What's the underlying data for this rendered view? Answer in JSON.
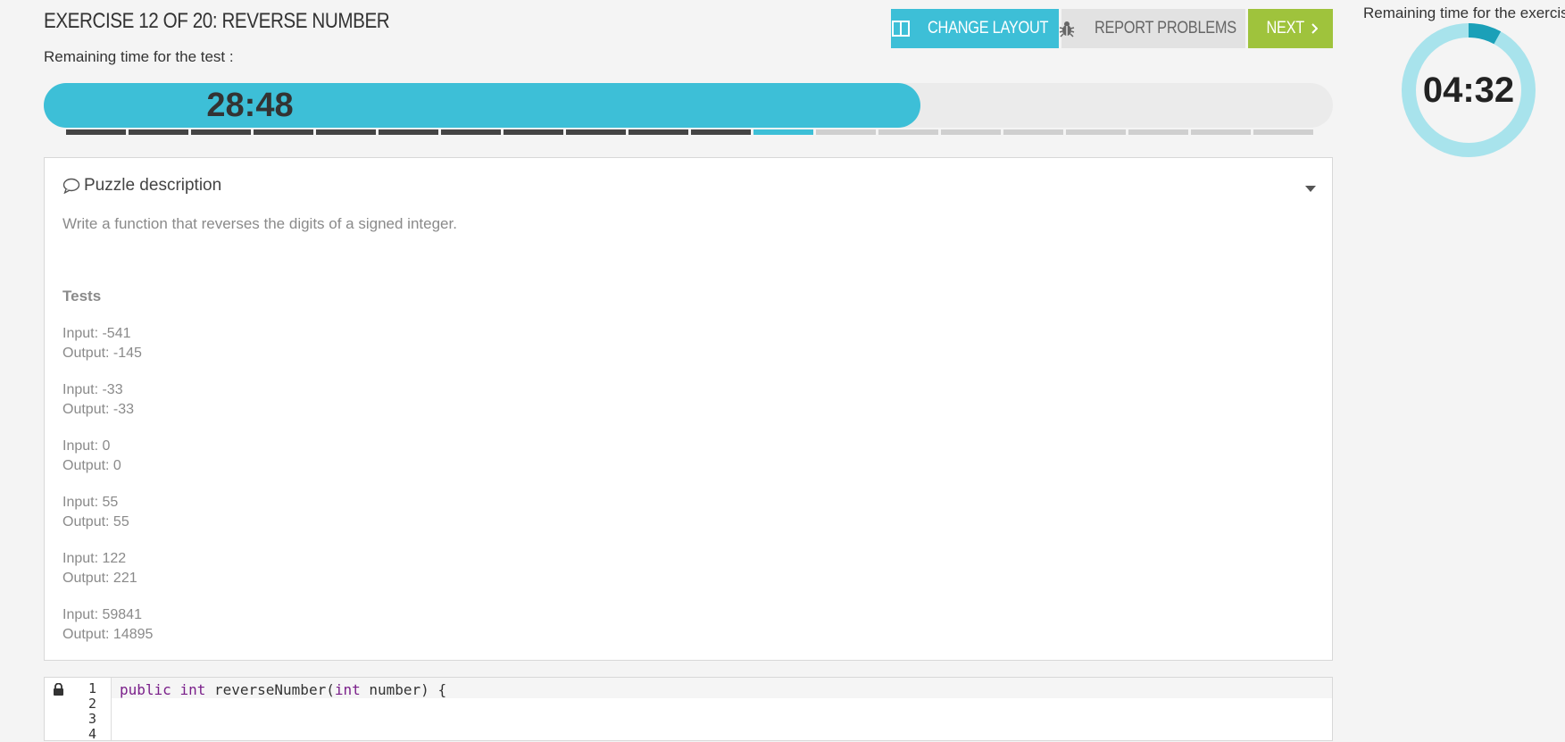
{
  "header": {
    "title": "EXERCISE 12 OF 20: REVERSE NUMBER",
    "remaining_test_label": "Remaining time for the test :"
  },
  "toolbar": {
    "change_layout_label": "CHANGE LAYOUT",
    "change_layout_icon": "columns-icon",
    "report_problems_label": "REPORT PROBLEMS",
    "report_problems_icon": "bug-icon",
    "next_label": "NEXT",
    "next_icon": "chevron-right-icon"
  },
  "test_timer": {
    "time": "28:48",
    "progress_fraction": 0.68
  },
  "exercise_progress": {
    "current": 12,
    "total": 20
  },
  "exercise_timer": {
    "label": "Remaining time for the exercise",
    "time": "04:32",
    "elapsed_fraction": 0.08
  },
  "puzzle": {
    "heading": "Puzzle description",
    "heading_icon": "speech-bubble-icon",
    "toggle_icon": "caret-down-icon",
    "description": "Write a function that reverses the digits of a signed integer.",
    "tests_title": "Tests",
    "tests": [
      {
        "input": "Input: -541",
        "output": "Output: -145"
      },
      {
        "input": "Input: -33",
        "output": "Output: -33"
      },
      {
        "input": "Input: 0",
        "output": "Output: 0"
      },
      {
        "input": "Input: 55",
        "output": "Output: 55"
      },
      {
        "input": "Input: 122",
        "output": "Output: 221"
      },
      {
        "input": "Input: 59841",
        "output": "Output: 14895"
      }
    ]
  },
  "editor": {
    "lock_icon": "lock-icon",
    "line_numbers": [
      "1",
      "2",
      "3",
      "4"
    ],
    "line1": {
      "kw_public": "public",
      "kw_int": "int",
      "fn": " reverseNumber(",
      "kw_int2": "int",
      "rest": " number) {"
    }
  },
  "colors": {
    "accent": "#3dbfd7",
    "next": "#9fc33c",
    "report_bg": "#e2e2e2",
    "segment_done": "#444444",
    "segment_todo": "#cfcfcf"
  }
}
